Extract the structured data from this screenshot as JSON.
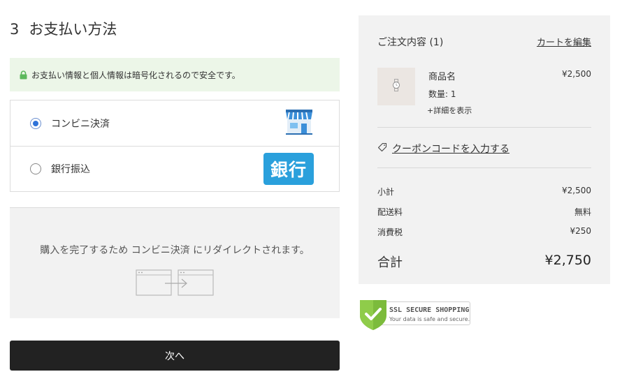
{
  "payment": {
    "step_number": "3",
    "title": "お支払い方法",
    "secure_message": "お支払い情報と個人情報は暗号化されるので安全です。",
    "methods": [
      {
        "label": "コンビニ決済",
        "selected": true,
        "icon": "convenience-store-icon"
      },
      {
        "label": "銀行振込",
        "selected": false,
        "icon": "bank-icon",
        "badge": "銀行"
      }
    ],
    "redirect_message": "購入を完了するため コンビニ決済 にリダイレクトされます。",
    "next_label": "次へ"
  },
  "summary": {
    "title": "ご注文内容 (1)",
    "edit_link": "カートを編集",
    "item": {
      "name": "商品名",
      "price": "¥2,500",
      "quantity": "数量: 1",
      "details_link": "+詳細を表示"
    },
    "coupon_link": "クーポンコードを入力する",
    "subtotal_label": "小計",
    "subtotal_value": "¥2,500",
    "shipping_label": "配送料",
    "shipping_value": "無料",
    "tax_label": "消費税",
    "tax_value": "¥250",
    "total_label": "合計",
    "total_value": "¥2,750"
  },
  "ssl_badge": {
    "title": "SSL SECURE SHOPPING",
    "subtitle": "Your data is safe and secure."
  },
  "colors": {
    "secure_bg": "#ecf6e8",
    "lock_green": "#5cb85c",
    "radio_blue": "#2f73d9",
    "bank_badge": "#2aa0dc",
    "button_bg": "#222222",
    "summary_bg": "#f2f2f2"
  }
}
